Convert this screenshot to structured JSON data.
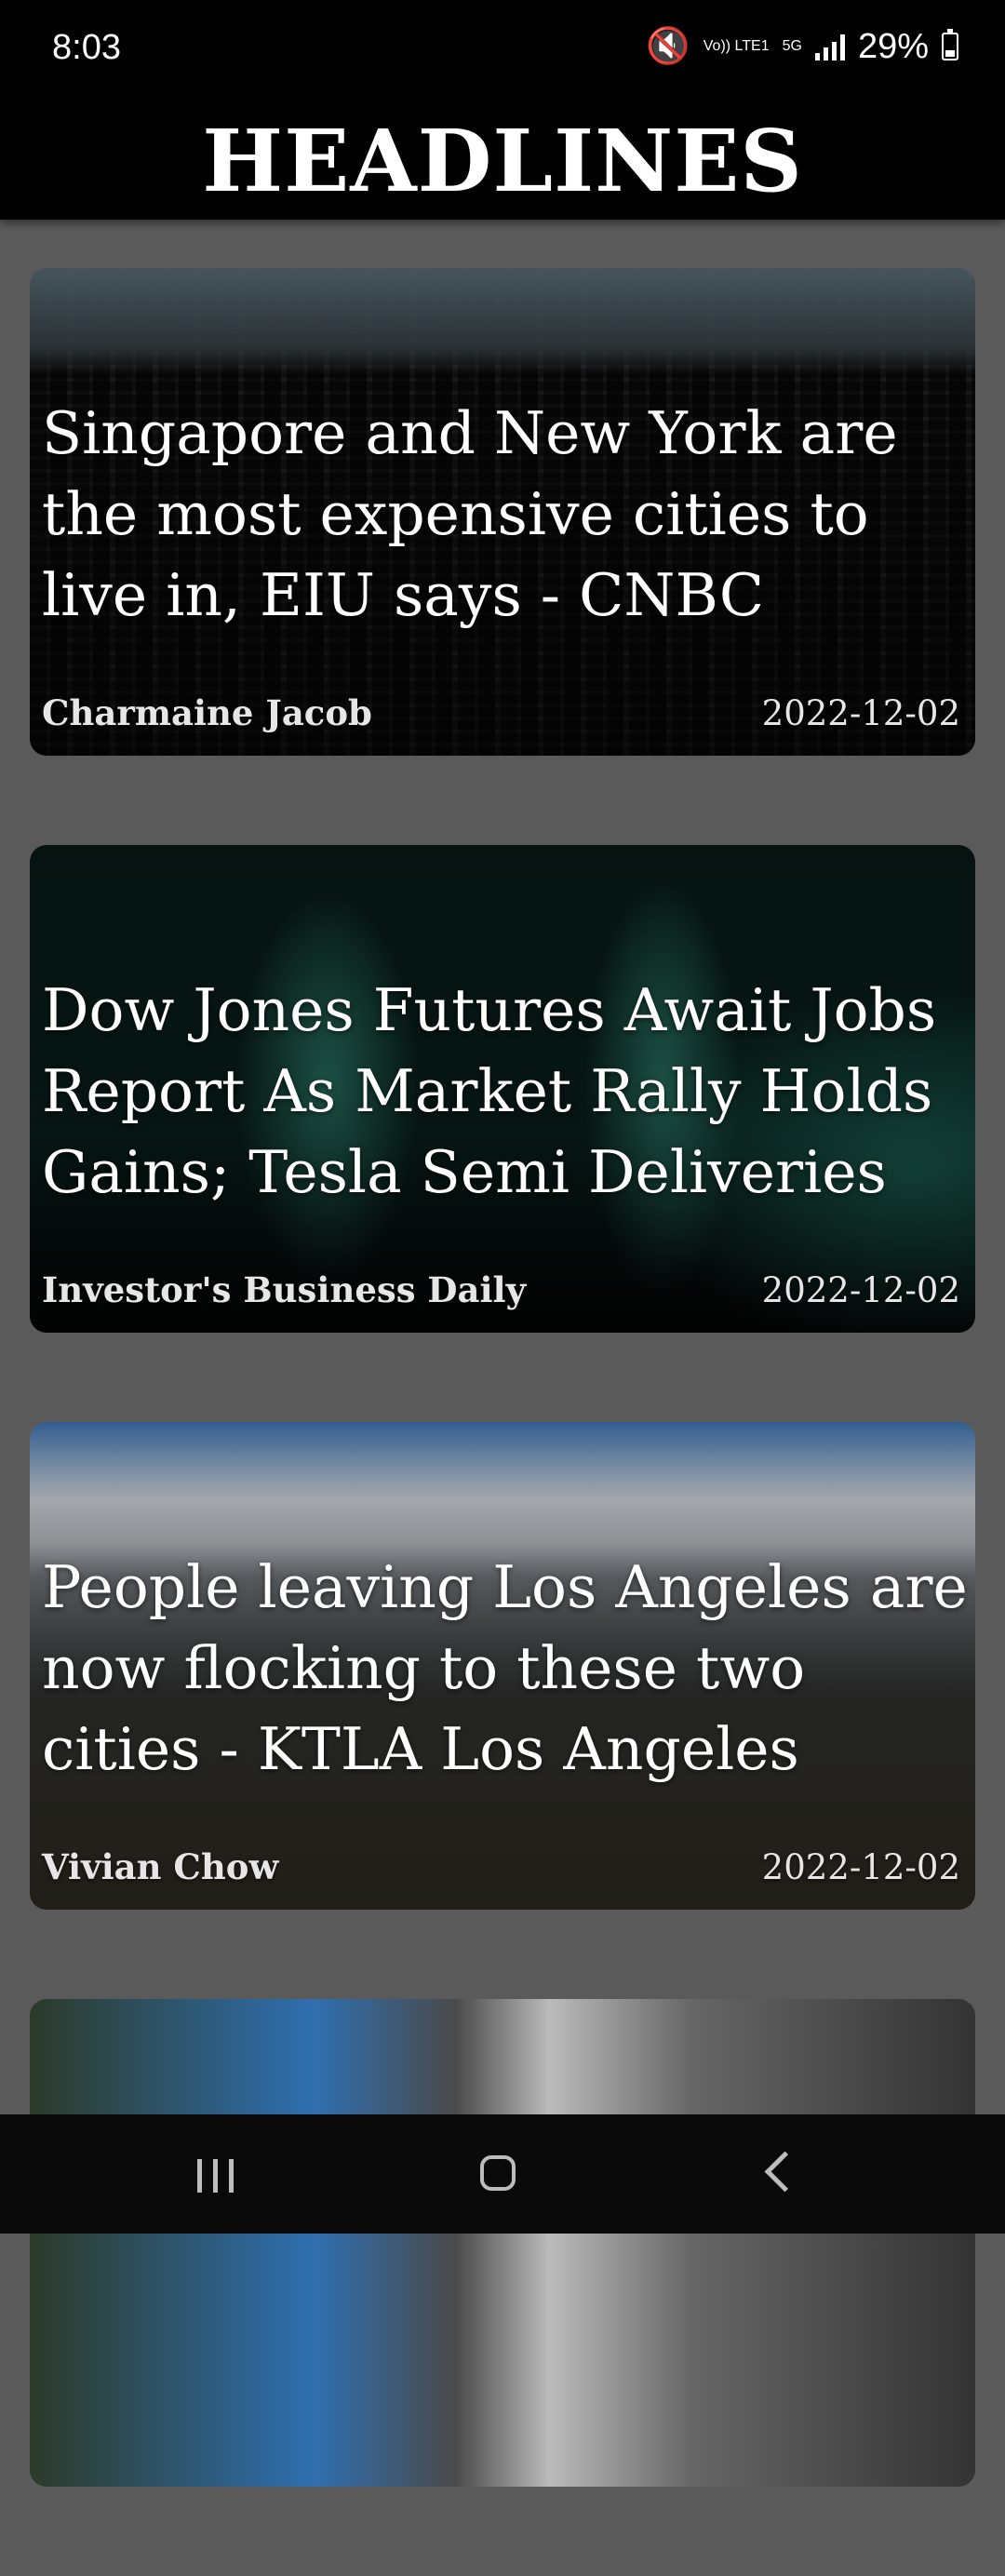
{
  "status_bar": {
    "time": "8:03",
    "volte_label": "Vo)) LTE1",
    "network_label": "5G",
    "battery": "29%"
  },
  "header": {
    "title": "HEADLINES"
  },
  "articles": [
    {
      "title": "Singapore and New York are the most expensive cities to live in, EIU says - CNBC",
      "source": "Charmaine Jacob",
      "date": "2022-12-02",
      "image": "city-aerial"
    },
    {
      "title": "Dow Jones Futures Await Jobs Report As Market Rally Holds Gains; Tesla Semi Deliveries",
      "source": "Investor's Business Daily",
      "date": "2022-12-02",
      "image": "tesla-semi-lights"
    },
    {
      "title": "People leaving Los Angeles are now flocking to these two cities - KTLA Los Angeles",
      "source": "Vivian Chow",
      "date": "2022-12-02",
      "image": "los-angeles-skyline"
    },
    {
      "title": "",
      "source": "",
      "date": "",
      "image": "city-street"
    }
  ],
  "nav": {
    "recents_icon": "recents-icon",
    "home_icon": "home-icon",
    "back_icon": "back-icon"
  },
  "colors": {
    "background": "#5a5a5a",
    "header": "#000000",
    "text": "#ffffff"
  }
}
